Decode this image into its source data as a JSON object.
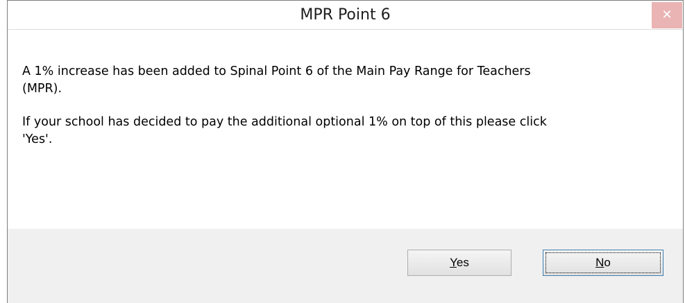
{
  "dialog": {
    "title": "MPR Point 6",
    "close_glyph": "✕",
    "paragraph1": "A 1% increase has been added to Spinal Point 6 of the Main Pay Range for Teachers (MPR).",
    "paragraph2": "If your school has decided to pay the additional optional 1% on top of this please click 'Yes'.",
    "yes_mnemonic": "Y",
    "yes_rest": "es",
    "no_mnemonic": "N",
    "no_rest": "o"
  },
  "colors": {
    "close_button_bg": "#eab4b4",
    "footer_bg": "#f0f0f0",
    "focus_border": "#3c7fb1"
  }
}
